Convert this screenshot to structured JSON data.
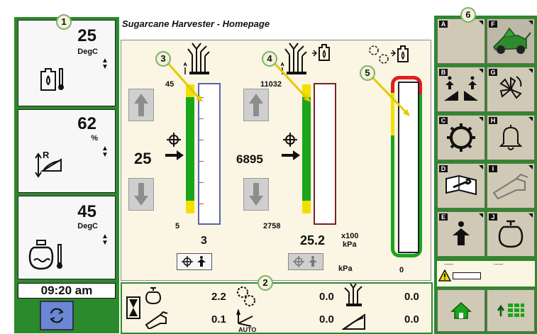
{
  "title": "Sugarcane Harvester - Homepage",
  "left_panel": {
    "items": [
      {
        "value": "25",
        "unit": "DegC",
        "icon": "hydraulic-oil-temp-icon"
      },
      {
        "value": "62",
        "unit": "%",
        "icon": "reverse-pressure-icon"
      },
      {
        "value": "45",
        "unit": "DegC",
        "icon": "coolant-temp-icon"
      }
    ],
    "time": "09:20 am",
    "refresh_icon": "refresh-icon"
  },
  "gauges": {
    "g1": {
      "max_label": "45",
      "min_label": "5",
      "setpoint": "25",
      "reading": "3",
      "level": 0.0
    },
    "g2": {
      "max_label": "11032",
      "min_label": "2758",
      "setpoint": "6895",
      "reading": "25.2",
      "unit_top": "x100",
      "unit_bot": "kPa",
      "unit2": "kPa"
    },
    "g3": {
      "reading": "0"
    }
  },
  "status_bar": {
    "row1": {
      "a": "2.2",
      "b": "0.0",
      "c": "0.0"
    },
    "row2": {
      "a": "0.1",
      "b": "0.0",
      "c": "0.0"
    },
    "auto_label": "AUTO"
  },
  "right_panel": {
    "buttons": [
      "A",
      "F",
      "B",
      "G",
      "C",
      "H",
      "D",
      "I",
      "E",
      "J"
    ],
    "status_dashes_1": "-----",
    "status_dashes_2": "-----"
  },
  "callouts": [
    "1",
    "2",
    "3",
    "4",
    "5",
    "6"
  ],
  "colors": {
    "panel_green": "#2b8a2b",
    "gauge_green": "#1aa51a",
    "gauge_yellow": "#f0e000",
    "gauge_red": "#e02020",
    "callout_border": "#7ab36a"
  }
}
